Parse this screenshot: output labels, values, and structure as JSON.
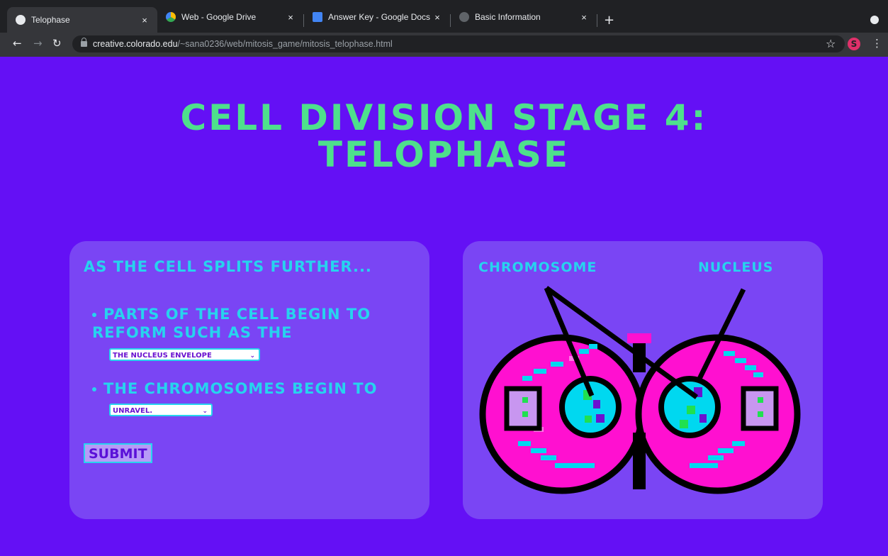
{
  "browser": {
    "tabs": [
      {
        "title": "Telophase",
        "active": true
      },
      {
        "title": "Web - Google Drive",
        "active": false
      },
      {
        "title": "Answer Key - Google Docs",
        "active": false
      },
      {
        "title": "Basic Information",
        "active": false
      }
    ],
    "new_tab": "+",
    "close": "×",
    "url_host": "creative.colorado.edu",
    "url_path": "/~sana0236/web/mitosis_game/mitosis_telophase.html",
    "extension_letter": "S"
  },
  "page": {
    "title_line1": "CELL DIVISION STAGE 4:",
    "title_line2": "TELOPHASE",
    "left_panel": {
      "heading": "AS THE CELL SPLITS FURTHER...",
      "bullet1_line1": "PARTS OF THE CELL BEGIN TO",
      "bullet1_line2": "REFORM SUCH AS THE",
      "select1_value": "THE NUCLEUS ENVELOPE",
      "bullet2": "THE CHROMOSOMES BEGIN TO",
      "select2_value": "UNRAVEL.",
      "submit_label": "SUBMIT"
    },
    "right_panel": {
      "label_chromosome": "CHROMOSOME",
      "label_nucleus": "NUCLEUS"
    }
  },
  "colors": {
    "background": "#6410f5",
    "panel": "#7a45f4",
    "title": "#4ee08c",
    "text": "#27d3ee",
    "cell_pink": "#ff10d0",
    "nucleus_cyan": "#00d8f0"
  }
}
